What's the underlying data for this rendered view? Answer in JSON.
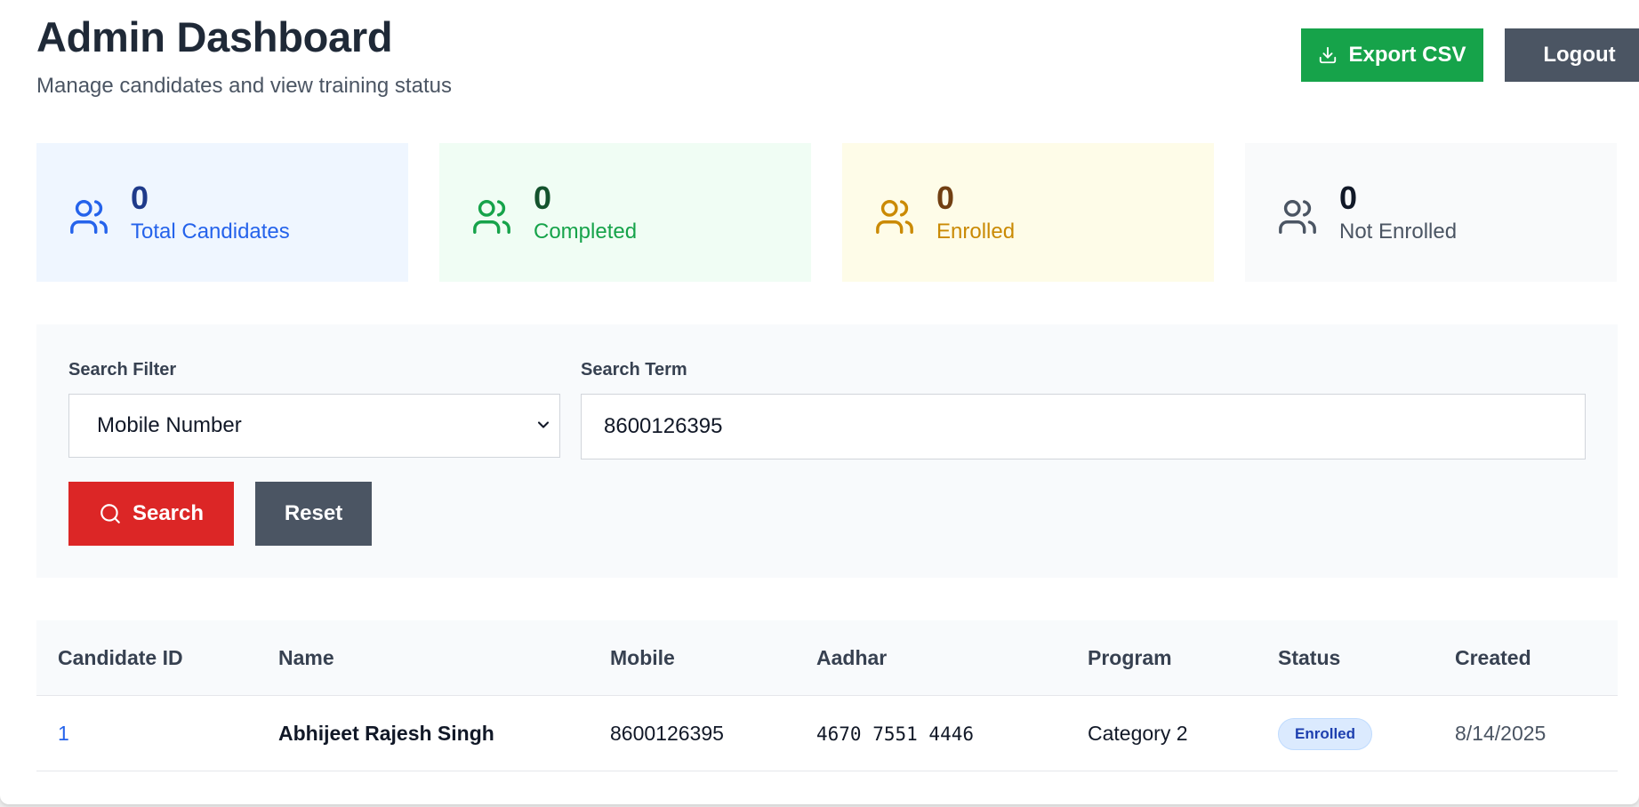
{
  "header": {
    "title": "Admin Dashboard",
    "subtitle": "Manage candidates and view training status",
    "export_label": "Export CSV",
    "logout_label": "Logout"
  },
  "stats": [
    {
      "value": "0",
      "label": "Total Candidates",
      "icon": "users-icon",
      "color": "#2563eb",
      "value_color": "#1e3a8a"
    },
    {
      "value": "0",
      "label": "Completed",
      "icon": "users-icon",
      "color": "#16a34a",
      "value_color": "#14532d"
    },
    {
      "value": "0",
      "label": "Enrolled",
      "icon": "users-icon",
      "color": "#ca8a04",
      "value_color": "#713f12"
    },
    {
      "value": "0",
      "label": "Not Enrolled",
      "icon": "users-icon",
      "color": "#4b5563",
      "value_color": "#111827"
    }
  ],
  "search": {
    "filter_label": "Search Filter",
    "filter_value": "Mobile Number",
    "term_label": "Search Term",
    "term_value": "8600126395",
    "search_label": "Search",
    "reset_label": "Reset"
  },
  "table": {
    "headers": [
      "Candidate ID",
      "Name",
      "Mobile",
      "Aadhar",
      "Program",
      "Status",
      "Created"
    ],
    "rows": [
      {
        "id": "1",
        "name": "Abhijeet Rajesh Singh",
        "mobile": "8600126395",
        "aadhar": "4670 7551 4446",
        "program": "Category 2",
        "status": "Enrolled",
        "created": "8/14/2025"
      }
    ]
  },
  "colors": {
    "export_button": "#16a34a",
    "logout_button": "#4b5563",
    "search_button": "#dc2626",
    "reset_button": "#4b5563",
    "status_badge_bg": "#dbeafe",
    "status_badge_text": "#1e40af"
  }
}
